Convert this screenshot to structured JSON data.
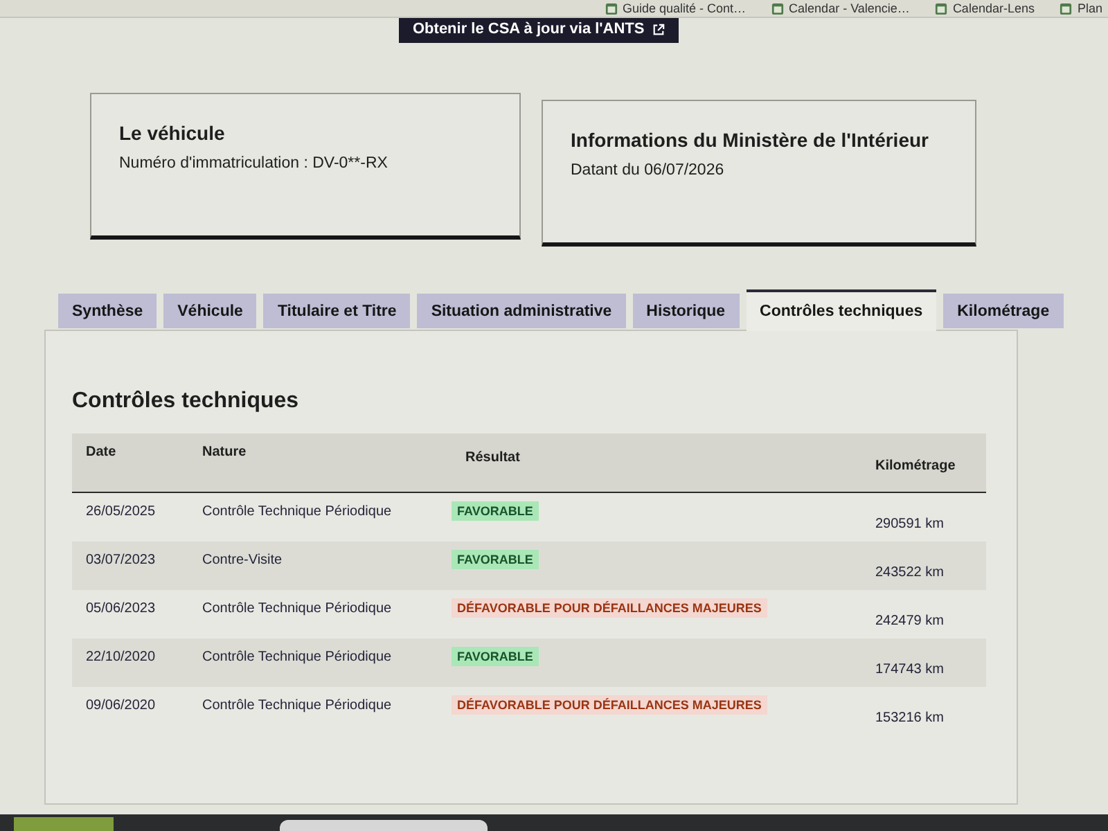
{
  "bookmarks": [
    {
      "label": "Guide qualité - Cont…"
    },
    {
      "label": "Calendar - Valencie…"
    },
    {
      "label": "Calendar-Lens"
    },
    {
      "label": "Plan"
    }
  ],
  "csa_button": {
    "label": "Obtenir le CSA à jour via l'ANTS"
  },
  "cards": [
    {
      "title": "Le véhicule",
      "text": "Numéro d'immatriculation : DV-0**-RX"
    },
    {
      "title": "Informations du Ministère de l'Intérieur",
      "text": "Datant du 06/07/2026"
    }
  ],
  "tabs": [
    {
      "label": "Synthèse",
      "selected": false
    },
    {
      "label": "Véhicule",
      "selected": false
    },
    {
      "label": "Titulaire et Titre",
      "selected": false
    },
    {
      "label": "Situation administrative",
      "selected": false
    },
    {
      "label": "Historique",
      "selected": false
    },
    {
      "label": "Contrôles techniques",
      "selected": true
    },
    {
      "label": "Kilométrage",
      "selected": false
    }
  ],
  "panel": {
    "title": "Contrôles techniques",
    "table": {
      "columns": [
        "Date",
        "Nature",
        "Résultat",
        "Kilométrage"
      ],
      "rows": [
        {
          "date": "26/05/2025",
          "nature": "Contrôle Technique Périodique",
          "result": {
            "label": "FAVORABLE",
            "kind": "favorable"
          },
          "mileage": "290591 km"
        },
        {
          "date": "03/07/2023",
          "nature": "Contre-Visite",
          "result": {
            "label": "FAVORABLE",
            "kind": "favorable"
          },
          "mileage": "243522 km"
        },
        {
          "date": "05/06/2023",
          "nature": "Contrôle Technique Périodique",
          "result": {
            "label": "DÉFAVORABLE POUR DÉFAILLANCES MAJEURES",
            "kind": "defavorable"
          },
          "mileage": "242479 km"
        },
        {
          "date": "22/10/2020",
          "nature": "Contrôle Technique Périodique",
          "result": {
            "label": "FAVORABLE",
            "kind": "favorable"
          },
          "mileage": "174743 km"
        },
        {
          "date": "09/06/2020",
          "nature": "Contrôle Technique Périodique",
          "result": {
            "label": "DÉFAVORABLE POUR DÉFAILLANCES MAJEURES",
            "kind": "defavorable"
          },
          "mileage": "153216 km"
        }
      ]
    }
  }
}
